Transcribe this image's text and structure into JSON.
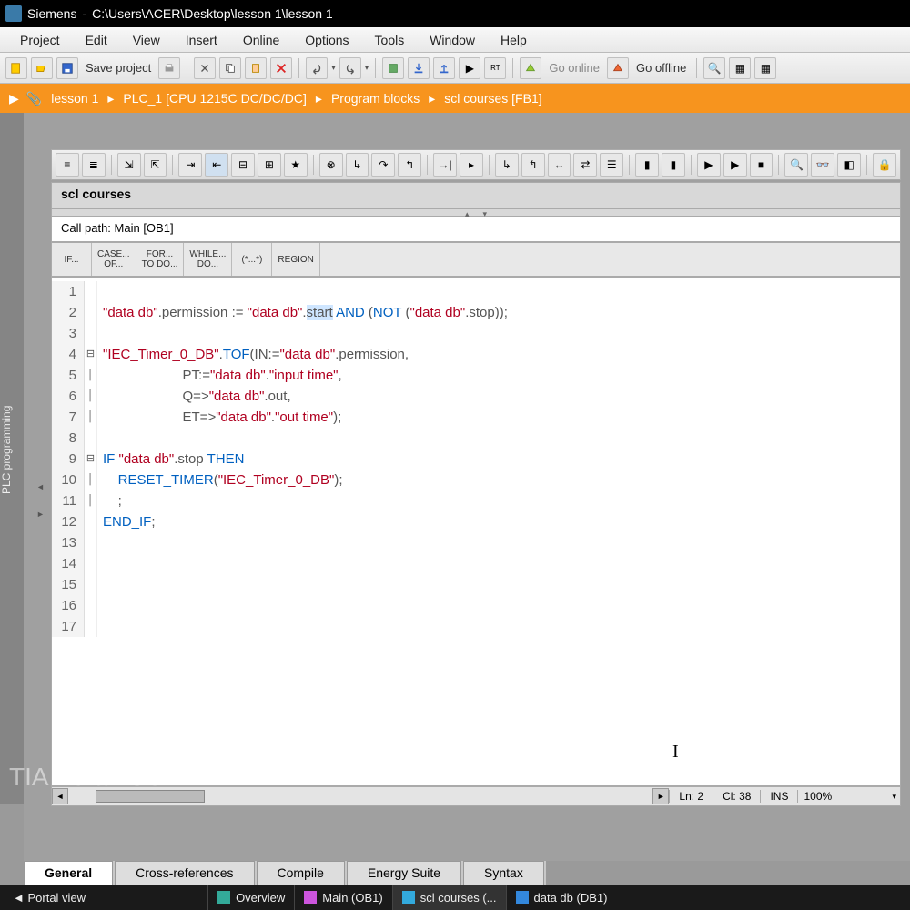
{
  "titlebar": {
    "vendor": "Siemens",
    "sep": "-",
    "path": "C:\\Users\\ACER\\Desktop\\lesson 1\\lesson 1"
  },
  "menubar": [
    "Project",
    "Edit",
    "View",
    "Insert",
    "Online",
    "Options",
    "Tools",
    "Window",
    "Help"
  ],
  "toolbar": {
    "save_label": "Save project",
    "go_online": "Go online",
    "go_offline": "Go offline"
  },
  "breadcrumb": [
    "lesson 1",
    "PLC_1 [CPU 1215C DC/DC/DC]",
    "Program blocks",
    "scl courses [FB1]"
  ],
  "leftrail": "PLC programming",
  "editor": {
    "title": "scl courses",
    "callpath": "Call path: Main [OB1]",
    "snips": [
      {
        "l1": "IF...",
        "l2": ""
      },
      {
        "l1": "CASE...",
        "l2": "OF..."
      },
      {
        "l1": "FOR...",
        "l2": "TO DO..."
      },
      {
        "l1": "WHILE...",
        "l2": "DO..."
      },
      {
        "l1": "(*...*)",
        "l2": ""
      },
      {
        "l1": "REGION",
        "l2": ""
      }
    ],
    "code": [
      {
        "n": 1,
        "fold": "",
        "txt": ""
      },
      {
        "n": 2,
        "fold": "",
        "pre": "\"data db\".permission := \"data db\".",
        "sel": "start",
        "post": " AND (NOT (\"data db\".stop));"
      },
      {
        "n": 3,
        "fold": "",
        "txt": ""
      },
      {
        "n": 4,
        "fold": "⊟",
        "txt": "\"IEC_Timer_0_DB\".TOF(IN:=\"data db\".permission,"
      },
      {
        "n": 5,
        "fold": "│",
        "txt": "                     PT:=\"data db\".\"input time\","
      },
      {
        "n": 6,
        "fold": "│",
        "txt": "                     Q=>\"data db\".out,"
      },
      {
        "n": 7,
        "fold": "│",
        "txt": "                     ET=>\"data db\".\"out time\");"
      },
      {
        "n": 8,
        "fold": "",
        "txt": ""
      },
      {
        "n": 9,
        "fold": "⊟",
        "txt": "IF \"data db\".stop THEN"
      },
      {
        "n": 10,
        "fold": "│",
        "txt": "    RESET_TIMER(\"IEC_Timer_0_DB\");"
      },
      {
        "n": 11,
        "fold": "│",
        "txt": "    ;"
      },
      {
        "n": 12,
        "fold": "",
        "txt": "END_IF;"
      },
      {
        "n": 13,
        "fold": "",
        "txt": ""
      },
      {
        "n": 14,
        "fold": "",
        "txt": ""
      },
      {
        "n": 15,
        "fold": "",
        "txt": ""
      },
      {
        "n": 16,
        "fold": "",
        "txt": ""
      },
      {
        "n": 17,
        "fold": "",
        "txt": ""
      }
    ],
    "status": {
      "ln": "Ln: 2",
      "cl": "Cl: 38",
      "ins": "INS",
      "zoom": "100%"
    }
  },
  "bottom_tabs": [
    "General",
    "Cross-references",
    "Compile",
    "Energy Suite",
    "Syntax"
  ],
  "statusbar": {
    "portal": "Portal view",
    "docs": [
      {
        "label": "Overview",
        "color": "#3a9"
      },
      {
        "label": "Main (OB1)",
        "color": "#c5d"
      },
      {
        "label": "scl courses (...",
        "color": "#3ad"
      },
      {
        "label": "data db (DB1)",
        "color": "#38d"
      }
    ]
  },
  "watermark": "TIA Portal SCL"
}
